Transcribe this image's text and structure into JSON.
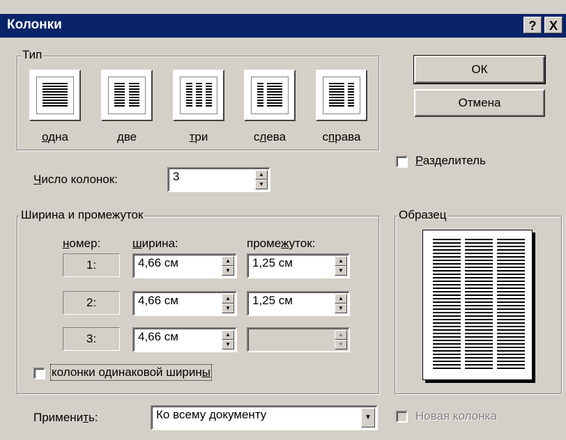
{
  "window": {
    "title": "Колонки",
    "help": "?",
    "close": "X"
  },
  "type_group": {
    "label": "Тип",
    "presets": [
      {
        "ul": "о",
        "rest": "дна"
      },
      {
        "ul": "д",
        "rest": "ве"
      },
      {
        "ul": "т",
        "rest": "ри"
      },
      {
        "pre": "с",
        "ul": "л",
        "rest": "ева"
      },
      {
        "pre": "с",
        "ul": "п",
        "rest": "рава"
      }
    ]
  },
  "buttons": {
    "ok": "ОК",
    "cancel": "Отмена"
  },
  "separator": {
    "ul": "Р",
    "rest": "азделитель"
  },
  "count": {
    "ul": "Ч",
    "rest": "исло колонок:",
    "value": "3"
  },
  "width_group": {
    "label": "Ширина и промежуток",
    "col_number": {
      "ul": "н",
      "rest": "омер:"
    },
    "col_width": {
      "ul": "ш",
      "rest": "ирина:"
    },
    "col_gap": {
      "pre": "проме",
      "ul": "ж",
      "rest": "уток:"
    },
    "rows": [
      {
        "num": "1:",
        "width": "4,66 см",
        "gap": "1,25 см"
      },
      {
        "num": "2:",
        "width": "4,66 см",
        "gap": "1,25 см"
      },
      {
        "num": "3:",
        "width": "4,66 см",
        "gap": ""
      }
    ],
    "equal_width": {
      "pre": "колонки одинаковой ширин",
      "ul": "ы"
    }
  },
  "sample": {
    "label": "Образец"
  },
  "apply": {
    "pre": "Примени",
    "ul": "т",
    "rest": "ь:",
    "value": "Ко всему документу"
  },
  "new_column": "Новая колонка"
}
